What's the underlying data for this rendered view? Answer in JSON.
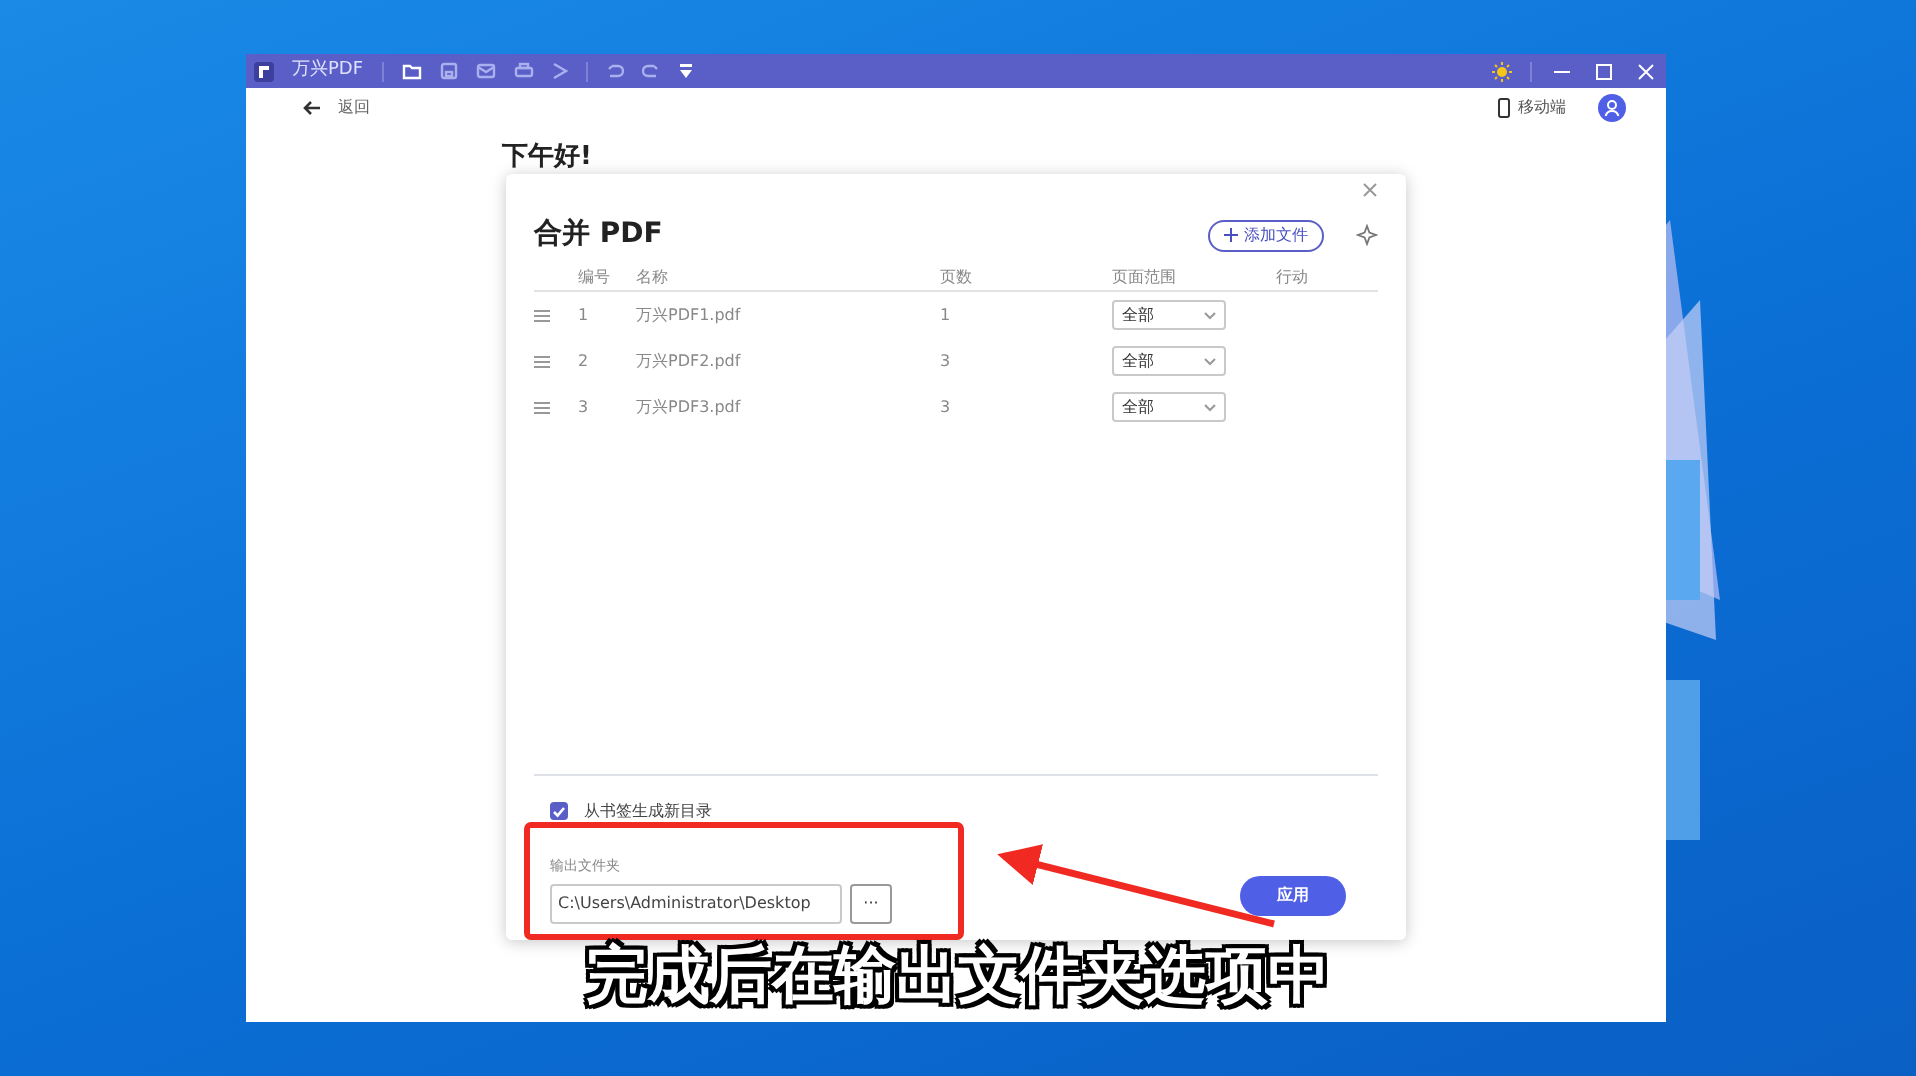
{
  "app": {
    "title": "万兴PDF",
    "back": "返回",
    "mobile": "移动端"
  },
  "greeting": "下午好!",
  "dialog": {
    "title": "合并 PDF",
    "add_button": "添加文件",
    "columns": [
      "编号",
      "名称",
      "页数",
      "页面范围",
      "行动"
    ],
    "rows": [
      {
        "number": "1",
        "name": "万兴PDF1.pdf",
        "pages": "1",
        "range": "全部"
      },
      {
        "number": "2",
        "name": "万兴PDF2.pdf",
        "pages": "3",
        "range": "全部"
      },
      {
        "number": "3",
        "name": "万兴PDF3.pdf",
        "pages": "3",
        "range": "全部"
      }
    ],
    "bookmark_option": {
      "label": "从书签生成新目录",
      "checked": true
    },
    "output": {
      "label": "输出文件夹",
      "value": "C:\\Users\\Administrator\\Desktop",
      "browse": "···"
    },
    "apply": "应用"
  },
  "subtitle": "完成后在输出文件夹选项中"
}
